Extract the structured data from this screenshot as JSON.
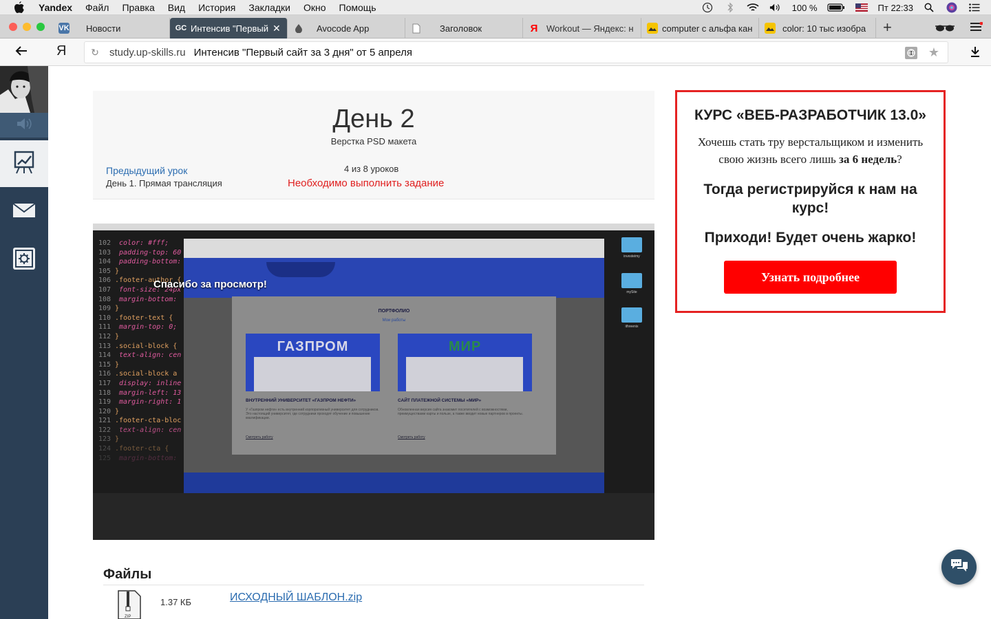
{
  "menubar": {
    "app": "Yandex",
    "items": [
      "Файл",
      "Правка",
      "Вид",
      "История",
      "Закладки",
      "Окно",
      "Помощь"
    ],
    "battery": "100 %",
    "clock": "Пт 22:33"
  },
  "tabs": [
    {
      "label": "Новости",
      "favicon": "vk-icon",
      "color": "#4a76a8"
    },
    {
      "label": "Интенсив \"Первый",
      "favicon": "gc-icon",
      "color": "#2b6cb0",
      "active": true
    },
    {
      "label": "Avocode App",
      "favicon": "avocode-icon",
      "color": "#333333"
    },
    {
      "label": "Заголовок",
      "favicon": "page-icon",
      "color": "#888888"
    },
    {
      "label": "Workout — Яндекс: н",
      "favicon": "yandex-icon",
      "color": "#ff0000"
    },
    {
      "label": "computer с альфа кан",
      "favicon": "image-icon",
      "color": "#f5c400"
    },
    {
      "label": "color: 10 тыс изобра",
      "favicon": "image-icon",
      "color": "#f5c400"
    }
  ],
  "addressbar": {
    "yandex_letter": "Я",
    "domain": "study.up-skills.ru",
    "page_title": "Интенсив \"Первый сайт за 3 дня\" от 5 апреля"
  },
  "lesson": {
    "title": "День 2",
    "subtitle": "Верстка PSD макета",
    "prev_link": "Предыдущий урок",
    "prev_title": "День 1. Прямая трансляция",
    "progress": "4 из 8 уроков",
    "required_text": "Необходимо выполнить задание"
  },
  "video": {
    "thanks": "Спасибо за просмотр!",
    "code_lines": [
      {
        "n": "102",
        "code": "  color: #fff;"
      },
      {
        "n": "103",
        "code": "  padding-top: 60"
      },
      {
        "n": "104",
        "code": "  padding-bottom:"
      },
      {
        "n": "105",
        "code": "}"
      },
      {
        "n": "106",
        "code": ".footer-author {"
      },
      {
        "n": "107",
        "code": "  font-size: 24px"
      },
      {
        "n": "108",
        "code": "  margin-bottom:"
      },
      {
        "n": "109",
        "code": "}"
      },
      {
        "n": "110",
        "code": ".footer-text {"
      },
      {
        "n": "111",
        "code": "  margin-top: 0;"
      },
      {
        "n": "112",
        "code": "}"
      },
      {
        "n": "113",
        "code": ".social-block {"
      },
      {
        "n": "114",
        "code": "  text-align: cen"
      },
      {
        "n": "115",
        "code": "}"
      },
      {
        "n": "116",
        "code": ".social-block a"
      },
      {
        "n": "117",
        "code": "  display: inline"
      },
      {
        "n": "118",
        "code": "  margin-left: 13"
      },
      {
        "n": "119",
        "code": "  margin-right: 1"
      },
      {
        "n": "120",
        "code": "}"
      },
      {
        "n": "121",
        "code": ".footer-cta-bloc"
      },
      {
        "n": "122",
        "code": "  text-align: cen"
      },
      {
        "n": "123",
        "code": "}"
      },
      {
        "n": "124",
        "code": ".footer-cta {"
      },
      {
        "n": "125",
        "code": "  margin-bottom:"
      }
    ],
    "portfolio_title": "ПОРТФОЛИО",
    "portfolio_sub": "Мои работы",
    "projects": [
      {
        "logo": "ГАЗПРОМ",
        "caption": "ВНУТРЕННИЙ УНИВЕРСИТЕТ «ГАЗПРОМ НЕФТИ»",
        "text": "У «Газпром нефти» есть внутренний корпоративный университет для сотрудников. Это настоящий университет, где сотрудники проходят обучение и повышение квалификации.",
        "link": "Смотреть работу"
      },
      {
        "logo": "МИР",
        "caption": "САЙТ ПЛАТЕЖНОЙ СИСТЕМЫ «МИР»",
        "text": "Обновленная версия сайта знакомит посетителей с возможностями, преимуществами карты и пользе, а также вводит новые партнеров в проекты.",
        "link": "Смотреть работу"
      }
    ],
    "desktop_folders": [
      "investeimy",
      "mySite",
      "ithreenix"
    ]
  },
  "files": {
    "title": "Файлы",
    "items": [
      {
        "size": "1.37 КБ",
        "name": "ИСХОДНЫЙ ШАБЛОН.zip",
        "type_label": "ZIP"
      }
    ]
  },
  "promo": {
    "title": "КУРС «ВЕБ-РАЗРАБОТЧИК 13.0»",
    "text_before": "Хочешь стать тру верстальщиком и изменить свою жизнь всего лишь ",
    "text_bold": "за 6 недель",
    "text_after": "?",
    "call": "Тогда регистрируйся к нам на курс!",
    "come": "Приходи! Будет очень жарко!",
    "button": "Узнать подробнее",
    "border_color": "#e52222",
    "button_color": "#ff0000"
  }
}
